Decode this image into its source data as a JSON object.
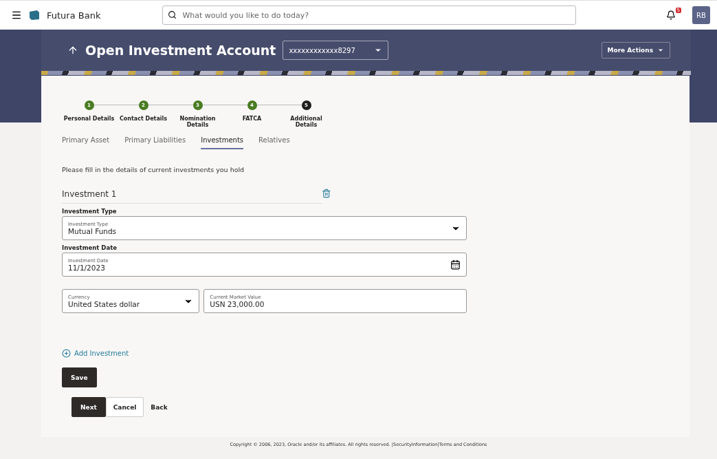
{
  "header": {
    "brand": "Futura Bank",
    "search_placeholder": "What would you like to do today?",
    "notification_count": "5",
    "avatar_initials": "RB"
  },
  "banner": {
    "title": "Open Investment Account",
    "account": "xxxxxxxxxxxx8297",
    "more_actions": "More Actions"
  },
  "steps": [
    {
      "number": "1",
      "label": "Personal Details",
      "completed": true
    },
    {
      "number": "2",
      "label": "Contact Details",
      "completed": true
    },
    {
      "number": "3",
      "label": "Nomination Details",
      "completed": true
    },
    {
      "number": "4",
      "label": "FATCA",
      "completed": true
    },
    {
      "number": "5",
      "label": "Additional Details",
      "completed": false
    }
  ],
  "tabs": [
    {
      "label": "Primary Asset",
      "selected": false
    },
    {
      "label": "Primary Liabilities",
      "selected": false
    },
    {
      "label": "Investments",
      "selected": true
    },
    {
      "label": "Relatives",
      "selected": false
    }
  ],
  "instruction": "Please fill in the details of current investments you hold",
  "investment": {
    "title": "Investment 1",
    "sections": [
      {
        "heading": "Investment Type",
        "fields": [
          {
            "kind": "select",
            "label": "Investment Type",
            "value": "Mutual Funds"
          }
        ]
      },
      {
        "heading": "Investment Date",
        "fields": [
          {
            "kind": "date",
            "label": "Investment Date",
            "value": "11/1/2023"
          }
        ]
      },
      {
        "fields": [
          {
            "kind": "select",
            "label": "Currency",
            "value": "United States dollar"
          },
          {
            "kind": "text",
            "label": "Current Market Value",
            "value": "USN 23,000.00"
          }
        ]
      }
    ]
  },
  "add_link": "Add Investment",
  "save": "Save",
  "actions": [
    {
      "label": "Next",
      "kind": "primary"
    },
    {
      "label": "Cancel",
      "kind": "secondary"
    },
    {
      "label": "Back",
      "kind": "link"
    }
  ],
  "footer": {
    "copyright": "Copyright © 2006, 2023, Oracle and/or its affiliates. All rights reserved.",
    "separator": "|",
    "links": [
      "SecurityInformation",
      "Terms and Conditions"
    ]
  }
}
